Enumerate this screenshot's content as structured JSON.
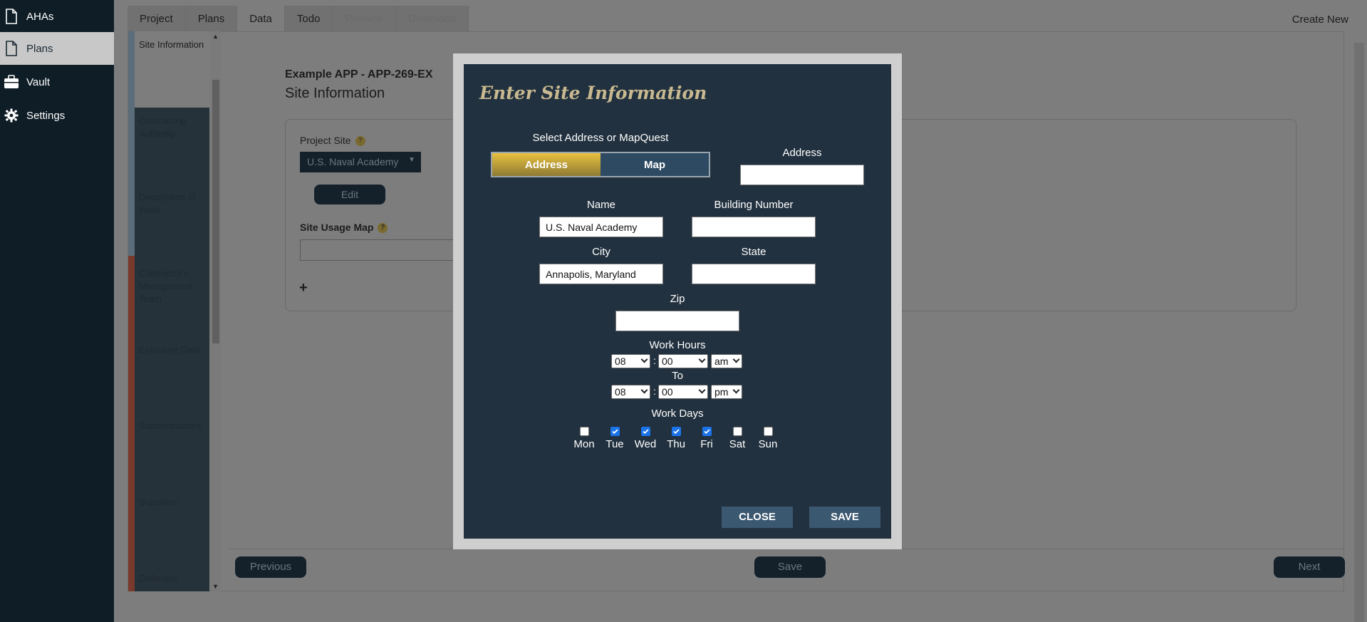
{
  "nav": {
    "items": [
      {
        "label": "AHAs",
        "icon": "document-icon"
      },
      {
        "label": "Plans",
        "icon": "document-icon"
      },
      {
        "label": "Vault",
        "icon": "briefcase-icon"
      },
      {
        "label": "Settings",
        "icon": "gear-icon"
      }
    ]
  },
  "header": {
    "tabs": [
      "Project",
      "Plans",
      "Data",
      "Todo",
      "Preview",
      "Download"
    ],
    "create_new": "Create New"
  },
  "steps": [
    "Site Information",
    "Contracting Authority",
    "Description of Work",
    "Contractor's Management Team",
    "Exposure Data",
    "Subcontractors",
    "Suppliers",
    "Definable"
  ],
  "page": {
    "title": "Example APP - APP-269-EX",
    "subtitle": "Site Information",
    "project_site_label": "Project Site",
    "project_site_value": "U.S. Naval Academy",
    "edit_label": "Edit",
    "site_usage_label": "Site Usage Map",
    "add_symbol": "+",
    "help_symbol": "?"
  },
  "footer": {
    "previous": "Previous",
    "save": "Save",
    "next": "Next"
  },
  "modal": {
    "title": "Enter Site Information",
    "select_label": "Select Address or MapQuest",
    "toggle": {
      "address": "Address",
      "map": "Map",
      "selected": "Address"
    },
    "address_label": "Address",
    "address_value": "",
    "name_label": "Name",
    "name_value": "U.S. Naval Academy",
    "building_label": "Building Number",
    "building_value": "",
    "city_label": "City",
    "city_value": "Annapolis, Maryland",
    "state_label": "State",
    "state_value": "",
    "zip_label": "Zip",
    "zip_value": "",
    "work_hours_label": "Work Hours",
    "to_label": "To",
    "start": {
      "hour": "08",
      "minute": "00",
      "ampm": "am"
    },
    "end": {
      "hour": "08",
      "minute": "00",
      "ampm": "pm"
    },
    "colon": ":",
    "work_days_label": "Work Days",
    "days": [
      {
        "label": "Mon",
        "checked": false
      },
      {
        "label": "Tue",
        "checked": true
      },
      {
        "label": "Wed",
        "checked": true
      },
      {
        "label": "Thu",
        "checked": true
      },
      {
        "label": "Fri",
        "checked": true
      },
      {
        "label": "Sat",
        "checked": false
      },
      {
        "label": "Sun",
        "checked": false
      }
    ],
    "close_label": "CLOSE",
    "save_label": "SAVE"
  }
}
